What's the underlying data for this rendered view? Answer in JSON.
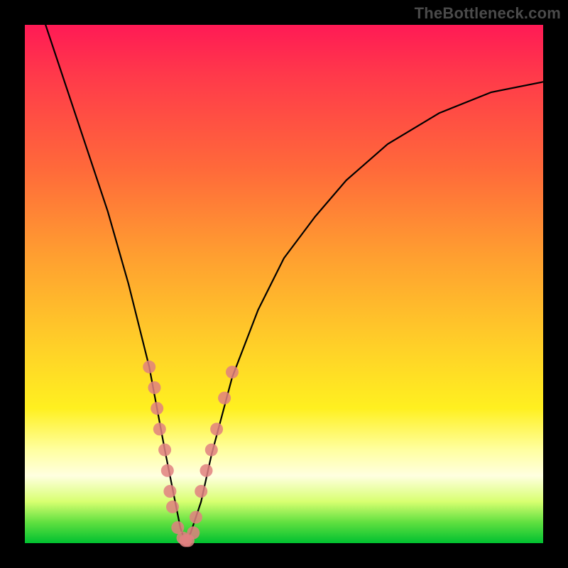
{
  "watermark": "TheBottleneck.com",
  "chart_data": {
    "type": "line",
    "title": "",
    "xlabel": "",
    "ylabel": "",
    "xlim": [
      0,
      100
    ],
    "ylim": [
      0,
      100
    ],
    "grid": false,
    "legend": false,
    "series": [
      {
        "name": "bottleneck-curve",
        "x": [
          4,
          8,
          12,
          16,
          20,
          24,
          27,
          29,
          30,
          31,
          32,
          34,
          36,
          40,
          45,
          50,
          56,
          62,
          70,
          80,
          90,
          100
        ],
        "values": [
          100,
          88,
          76,
          64,
          50,
          34,
          18,
          8,
          3,
          0,
          2,
          8,
          17,
          32,
          45,
          55,
          63,
          70,
          77,
          83,
          87,
          89
        ]
      }
    ],
    "markers": {
      "name": "highlighted-points",
      "color": "#e08080",
      "radius": 9,
      "points": [
        {
          "x": 24,
          "y": 34
        },
        {
          "x": 25,
          "y": 30
        },
        {
          "x": 25.5,
          "y": 26
        },
        {
          "x": 26,
          "y": 22
        },
        {
          "x": 27,
          "y": 18
        },
        {
          "x": 27.5,
          "y": 14
        },
        {
          "x": 28,
          "y": 10
        },
        {
          "x": 28.5,
          "y": 7
        },
        {
          "x": 29.5,
          "y": 3
        },
        {
          "x": 30.5,
          "y": 1
        },
        {
          "x": 31,
          "y": 0.5
        },
        {
          "x": 31.5,
          "y": 0.5
        },
        {
          "x": 32.5,
          "y": 2
        },
        {
          "x": 33,
          "y": 5
        },
        {
          "x": 34,
          "y": 10
        },
        {
          "x": 35,
          "y": 14
        },
        {
          "x": 36,
          "y": 18
        },
        {
          "x": 37,
          "y": 22
        },
        {
          "x": 38.5,
          "y": 28
        },
        {
          "x": 40,
          "y": 33
        }
      ]
    }
  }
}
